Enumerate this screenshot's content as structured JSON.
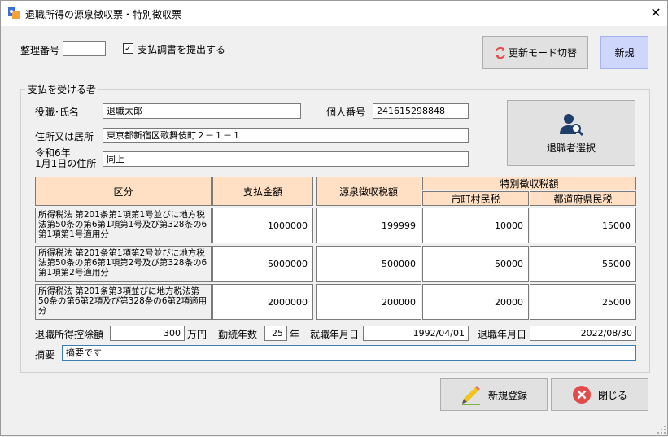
{
  "window": {
    "title": "退職所得の源泉徴収票・特別徴収票",
    "close_glyph": "✕"
  },
  "top": {
    "seiri_label": "整理番号",
    "seiri_value": "",
    "submit_label": "支払調書を提出する",
    "submit_checked_glyph": "✓",
    "mode_button": "更新モード切替",
    "new_button": "新規"
  },
  "recipient": {
    "group_title": "支払を受ける者",
    "name_label": "役職･氏名",
    "name_value": "退職太郎",
    "mynumber_label": "個人番号",
    "mynumber_value": "241615298848",
    "address_label": "住所又は居所",
    "address_value": "東京都新宿区歌舞伎町２－１－１",
    "jan1_label_line1": "令和6年",
    "jan1_label_line2": "1月1日の住所",
    "jan1_value": "同上",
    "select_button": "退職者選択"
  },
  "table": {
    "headers": {
      "kubun": "区分",
      "shiharai": "支払金額",
      "gensen": "源泉徴収税額",
      "tokubetsu": "特別徴収税額",
      "shichoson": "市町村民税",
      "todofuken": "都道府県民税"
    },
    "rows": [
      {
        "label": "所得税法 第201条第1項第1号並びに地方税法第50条の第6第1項第1号及び第328条の6第1項第1号適用分",
        "shiharai": "1000000",
        "gensen": "199999",
        "shichoson": "10000",
        "todofuken": "15000"
      },
      {
        "label": "所得税法 第201条第1項第2号並びに地方税法第50条の第6第1項第2号及び第328条の6第1項第2号適用分",
        "shiharai": "5000000",
        "gensen": "500000",
        "shichoson": "50000",
        "todofuken": "55000"
      },
      {
        "label": "所得税法 第201条第3項並びに地方税法第50条の第6第2項及び第328条の6第2項適用分",
        "shiharai": "2000000",
        "gensen": "200000",
        "shichoson": "20000",
        "todofuken": "25000"
      }
    ]
  },
  "bottom": {
    "deduction_label": "退職所得控除額",
    "deduction_value": "300",
    "deduction_unit": "万円",
    "years_label": "勤続年数",
    "years_value": "25",
    "years_unit": "年",
    "hire_label": "就職年月日",
    "hire_value": "1992/04/01",
    "retire_label": "退職年月日",
    "retire_value": "2022/08/30",
    "memo_label": "摘要",
    "memo_value": "摘要です"
  },
  "footer": {
    "register_button": "新規登録",
    "close_button": "閉じる"
  },
  "colors": {
    "header_bg": "#ffe0c4",
    "new_button_bg": "#cfd6fb",
    "accent_red": "#e24b4b"
  }
}
